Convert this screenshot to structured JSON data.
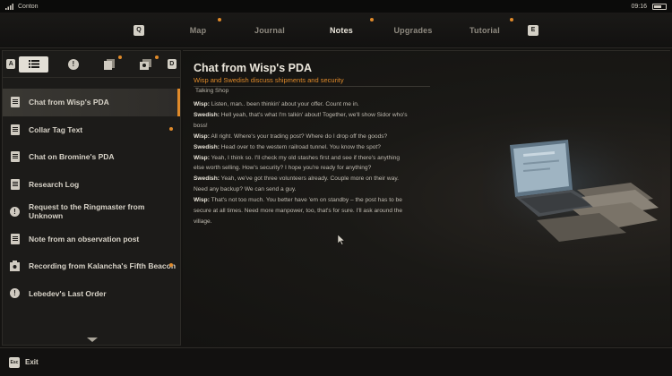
{
  "statusbar": {
    "carrier": "Conton",
    "time": "09:16"
  },
  "topnav": {
    "left_key": "Q",
    "right_key": "E",
    "tabs": [
      {
        "label": "Map",
        "has_new": true
      },
      {
        "label": "Journal",
        "has_new": false
      },
      {
        "label": "Notes",
        "has_new": true,
        "active": true
      },
      {
        "label": "Upgrades",
        "has_new": false
      },
      {
        "label": "Tutorial",
        "has_new": true
      }
    ]
  },
  "filters": {
    "left_key": "A",
    "right_key": "D",
    "buttons": [
      {
        "icon": "list-icon",
        "selected": true
      },
      {
        "icon": "alert-icon",
        "selected": false
      },
      {
        "icon": "notes-stack-icon",
        "has_new": true
      },
      {
        "icon": "photos-icon",
        "has_new": true
      }
    ]
  },
  "notes_list": [
    {
      "label": "Chat from Wisp's PDA",
      "icon": "document-icon",
      "selected": true,
      "has_new": false
    },
    {
      "label": "Collar Tag Text",
      "icon": "document-icon",
      "has_new": true
    },
    {
      "label": "Chat on Bromine's PDA",
      "icon": "document-icon",
      "has_new": false
    },
    {
      "label": "Research Log",
      "icon": "document-icon",
      "has_new": false
    },
    {
      "label": "Request to the Ringmaster from Unknown",
      "icon": "alert-icon",
      "has_new": false
    },
    {
      "label": "Note from an observation post",
      "icon": "document-icon",
      "has_new": false
    },
    {
      "label": "Recording from Kalancha's Fifth Beacon",
      "icon": "recording-icon",
      "has_new": true
    },
    {
      "label": "Lebedev's Last Order",
      "icon": "alert-icon",
      "has_new": false
    }
  ],
  "note": {
    "title": "Chat from Wisp's PDA",
    "subtitle": "Wisp and Swedish discuss shipments and security",
    "section": "Talking Shop",
    "lines": [
      {
        "speaker": "Wisp:",
        "text": " Listen, man.. been thinkin' about your offer. Count me in."
      },
      {
        "speaker": "Swedish:",
        "text": " Hell yeah, that's what I'm talkin' about! Together, we'll show Sidor who's boss!"
      },
      {
        "speaker": "Wisp:",
        "text": " All right. Where's your trading post? Where do I drop off the goods?"
      },
      {
        "speaker": "Swedish:",
        "text": " Head over to the western railroad tunnel. You know the spot?"
      },
      {
        "speaker": "Wisp:",
        "text": " Yeah, I think so. I'll check my old stashes first and see if there's anything else worth selling. How's security? I hope you're ready for anything?"
      },
      {
        "speaker": "Swedish:",
        "text": " Yeah, we've got three volunteers already. Couple more on their way. Need any backup? We can send a guy."
      },
      {
        "speaker": "Wisp:",
        "text": " That's not too much. You better have 'em on standby – the post has to be secure at all times. Need more manpower, too, that's for sure. I'll ask around the village."
      }
    ]
  },
  "bottombar": {
    "key": "Esc",
    "label": "Exit"
  },
  "colors": {
    "accent": "#e08a2a",
    "text": "#d8d3c8",
    "panel": "#1c1b19"
  }
}
